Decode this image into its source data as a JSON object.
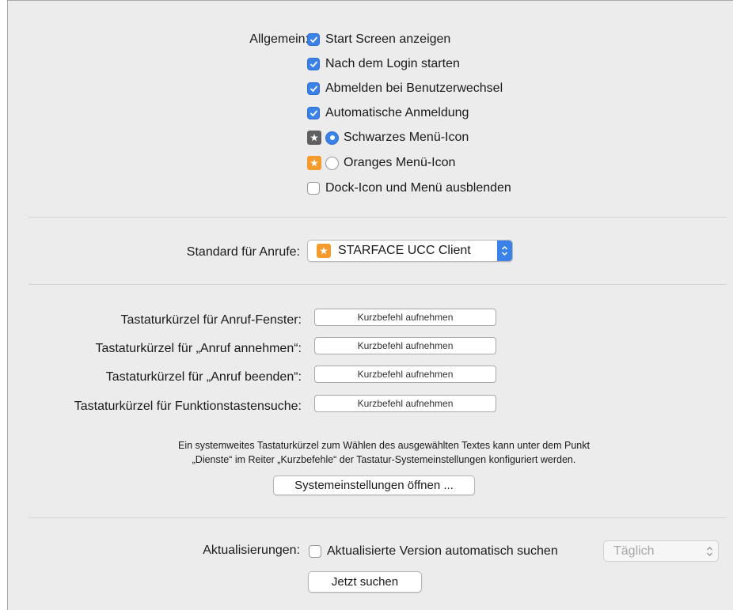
{
  "general": {
    "label": "Allgemein:",
    "options": [
      {
        "label": "Start Screen anzeigen",
        "checked": true
      },
      {
        "label": "Nach dem Login starten",
        "checked": true
      },
      {
        "label": "Abmelden bei Benutzerwechsel",
        "checked": true
      },
      {
        "label": "Automatische Anmeldung",
        "checked": true
      }
    ],
    "menu_icon_options": [
      {
        "label": "Schwarzes Menü-Icon",
        "selected": true,
        "icon": "dark-menu-icon"
      },
      {
        "label": "Oranges Menü-Icon",
        "selected": false,
        "icon": "orange-menu-icon"
      }
    ],
    "hide_dock": {
      "label": "Dock-Icon und Menü ausblenden",
      "checked": false
    }
  },
  "calls": {
    "label": "Standard für Anrufe:",
    "selected_app": "STARFACE UCC Client",
    "app_icon": "starface-icon"
  },
  "shortcuts": {
    "rows": [
      {
        "label": "Tastaturkürzel für Anruf-Fenster:",
        "button": "Kurzbefehl aufnehmen"
      },
      {
        "label": "Tastaturkürzel für „Anruf annehmen“:",
        "button": "Kurzbefehl aufnehmen"
      },
      {
        "label": "Tastaturkürzel für „Anruf beenden“:",
        "button": "Kurzbefehl aufnehmen"
      },
      {
        "label": "Tastaturkürzel für Funktionstastensuche:",
        "button": "Kurzbefehl aufnehmen"
      }
    ],
    "info_line1": "Ein systemweites Tastaturkürzel zum Wählen des ausgewählten Textes kann unter dem Punkt",
    "info_line2": "„Dienste“ im Reiter „Kurzbefehle“ der Tastatur-Systemeinstellungen konfiguriert werden.",
    "open_settings_button": "Systemeinstellungen öffnen ..."
  },
  "updates": {
    "label": "Aktualisierungen:",
    "auto_check": {
      "label": "Aktualisierte Version automatisch suchen",
      "checked": false
    },
    "frequency": "Täglich",
    "check_now_button": "Jetzt suchen"
  },
  "colors": {
    "accent": "#3b82e8",
    "panel_bg": "#ececec",
    "orange_icon": "#f59a2d",
    "dark_icon": "#5f5f5f"
  }
}
